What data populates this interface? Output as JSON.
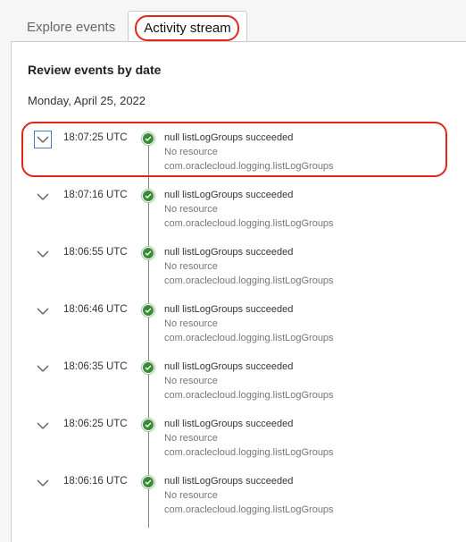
{
  "tabs": [
    {
      "label": "Explore events",
      "active": false
    },
    {
      "label": "Activity stream",
      "active": true
    }
  ],
  "section_title": "Review events by date",
  "date_heading": "Monday, April 25, 2022",
  "colors": {
    "highlight": "#e3261d",
    "success": "#3a8a3a",
    "focus": "#4a7fcf"
  },
  "events": [
    {
      "time": "18:07:25 UTC",
      "title": "null listLogGroups succeeded",
      "resource": "No resource",
      "event_type": "com.oraclecloud.logging.listLogGroups",
      "status_icon": "check-circle-icon"
    },
    {
      "time": "18:07:16 UTC",
      "title": "null listLogGroups succeeded",
      "resource": "No resource",
      "event_type": "com.oraclecloud.logging.listLogGroups",
      "status_icon": "check-circle-icon"
    },
    {
      "time": "18:06:55 UTC",
      "title": "null listLogGroups succeeded",
      "resource": "No resource",
      "event_type": "com.oraclecloud.logging.listLogGroups",
      "status_icon": "check-circle-icon"
    },
    {
      "time": "18:06:46 UTC",
      "title": "null listLogGroups succeeded",
      "resource": "No resource",
      "event_type": "com.oraclecloud.logging.listLogGroups",
      "status_icon": "check-circle-icon"
    },
    {
      "time": "18:06:35 UTC",
      "title": "null listLogGroups succeeded",
      "resource": "No resource",
      "event_type": "com.oraclecloud.logging.listLogGroups",
      "status_icon": "check-circle-icon"
    },
    {
      "time": "18:06:25 UTC",
      "title": "null listLogGroups succeeded",
      "resource": "No resource",
      "event_type": "com.oraclecloud.logging.listLogGroups",
      "status_icon": "check-circle-icon"
    },
    {
      "time": "18:06:16 UTC",
      "title": "null listLogGroups succeeded",
      "resource": "No resource",
      "event_type": "com.oraclecloud.logging.listLogGroups",
      "status_icon": "check-circle-icon"
    }
  ]
}
